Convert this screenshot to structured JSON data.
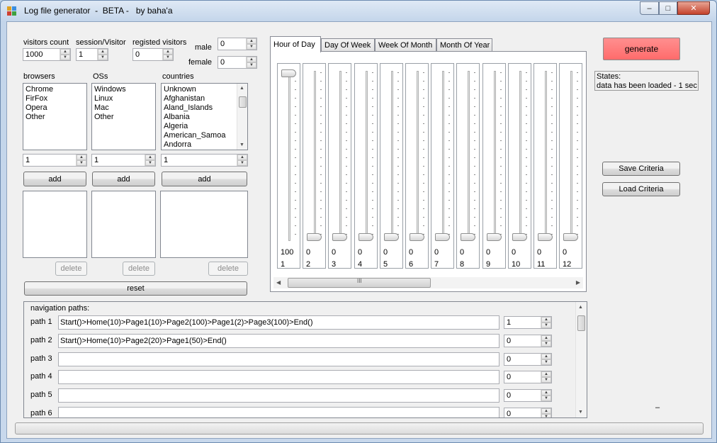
{
  "window": {
    "title": "Log file generator  -  BETA -   by baha'a"
  },
  "controls": {
    "minimize_glyph": "–",
    "maximize_glyph": "□",
    "close_glyph": "✕"
  },
  "visitors": {
    "visitors_count_label": "visitors count",
    "visitors_count_value": "1000",
    "session_label": "session/Visitor",
    "session_value": "1",
    "registed_label": "registed visitors",
    "registed_value": "0",
    "male_label": "male",
    "male_value": "0",
    "female_label": "female",
    "female_value": "0"
  },
  "browsers": {
    "label": "browsers",
    "items": [
      "Chrome",
      "FirFox",
      "Opera",
      "Other"
    ],
    "spin_value": "1",
    "add_label": "add",
    "delete_label": "delete"
  },
  "oss": {
    "label": "OSs",
    "items": [
      "Windows",
      "Linux",
      "Mac",
      "Other"
    ],
    "spin_value": "1",
    "add_label": "add",
    "delete_label": "delete"
  },
  "countries": {
    "label": "countries",
    "items": [
      "Unknown",
      "Afghanistan",
      "Aland_Islands",
      "Albania",
      "Algeria",
      "American_Samoa",
      "Andorra"
    ],
    "spin_value": "1",
    "add_label": "add",
    "delete_label": "delete"
  },
  "reset_label": "reset",
  "tabs": [
    "Hour of Day",
    "Day Of Week",
    "Week Of Month",
    "Month Of Year"
  ],
  "sliders": [
    {
      "value": "100",
      "label": "1",
      "level": 1
    },
    {
      "value": "0",
      "label": "2",
      "level": 0
    },
    {
      "value": "0",
      "label": "3",
      "level": 0
    },
    {
      "value": "0",
      "label": "4",
      "level": 0
    },
    {
      "value": "0",
      "label": "5",
      "level": 0
    },
    {
      "value": "0",
      "label": "6",
      "level": 0
    },
    {
      "value": "0",
      "label": "7",
      "level": 0
    },
    {
      "value": "0",
      "label": "8",
      "level": 0
    },
    {
      "value": "0",
      "label": "9",
      "level": 0
    },
    {
      "value": "0",
      "label": "10",
      "level": 0
    },
    {
      "value": "0",
      "label": "11",
      "level": 0
    },
    {
      "value": "0",
      "label": "12",
      "level": 0
    }
  ],
  "hscroll_grip": "III",
  "generate_label": "generate",
  "states": {
    "label": "States:",
    "message": "data has been loaded - 1 sec"
  },
  "save_criteria_label": "Save Criteria",
  "load_criteria_label": "Load Criteria",
  "nav": {
    "title": "navigation paths:",
    "paths": [
      {
        "label": "path 1",
        "value": "Start()>Home(10)>Page1(10)>Page2(100)>Page1(2)>Page3(100)>End()",
        "count": "1"
      },
      {
        "label": "path 2",
        "value": "Start()>Home(10)>Page2(20)>Page1(50)>End()",
        "count": "0"
      },
      {
        "label": "path 3",
        "value": "",
        "count": "0"
      },
      {
        "label": "path 4",
        "value": "",
        "count": "0"
      },
      {
        "label": "path 5",
        "value": "",
        "count": "0"
      },
      {
        "label": "path 6",
        "value": "",
        "count": "0"
      }
    ]
  },
  "dash_text": "–",
  "icons": {
    "spin_up": "▲",
    "spin_down": "▼",
    "scroll_up": "▲",
    "scroll_down": "▼",
    "scroll_left": "◀",
    "scroll_right": "▶"
  }
}
